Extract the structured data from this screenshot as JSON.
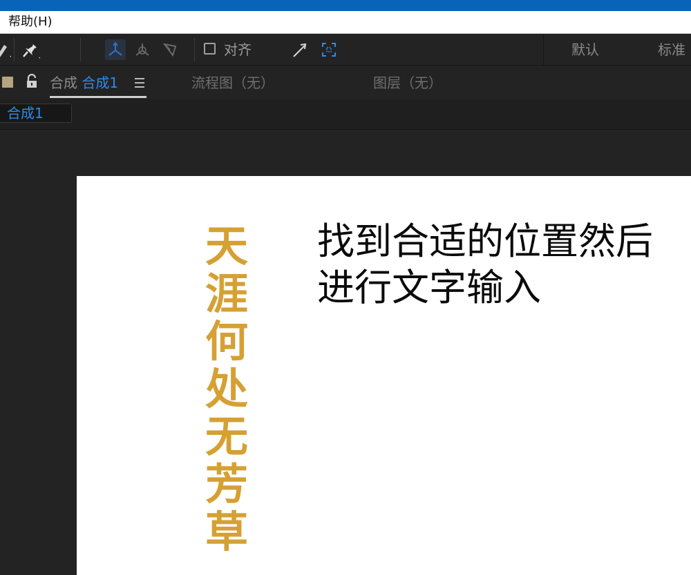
{
  "menubar": {
    "help_label": "帮助(H)"
  },
  "toolbar": {
    "snap_label": "对齐",
    "workspaces": [
      "默认",
      "标准"
    ]
  },
  "panel": {
    "tab_prefix": "合成",
    "active_comp": "合成1",
    "flowchart_tab": "流程图（无）",
    "layer_tab": "图层（无）",
    "breadcrumb": "合成1"
  },
  "canvas": {
    "vertical_text": "天涯何处无芳草",
    "horizontal_text": "找到合适的位置然后\n进行文字输入"
  },
  "colors": {
    "accent_blue": "#2d8ceb",
    "title_gold": "#d6a033",
    "titlebar_blue": "#0963b8"
  }
}
